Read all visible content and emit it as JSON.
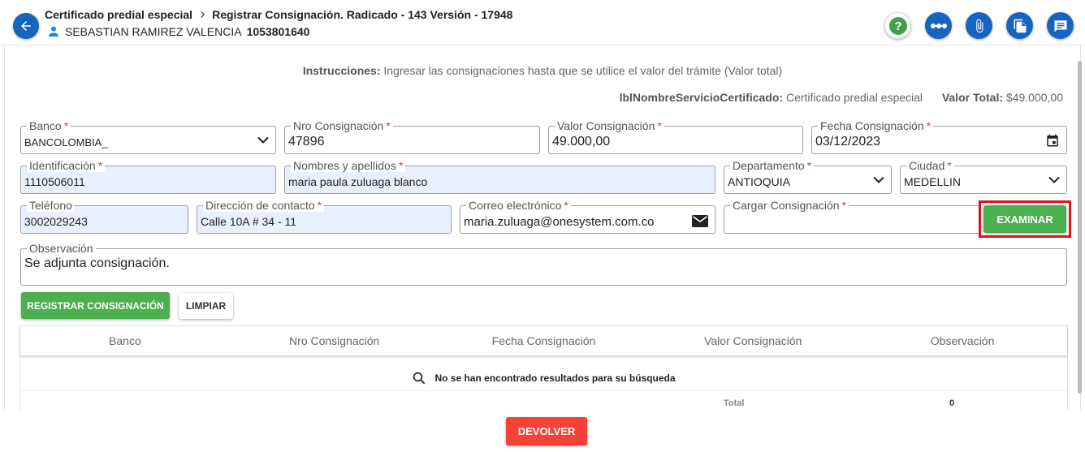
{
  "header": {
    "crumb_service": "Certificado predial especial",
    "crumb_step": "Registrar Consignación. Radicado - 143 Versión - 17948",
    "user_name": "SEBASTIAN RAMIREZ VALENCIA",
    "user_doc": "1053801640"
  },
  "info": {
    "instructions_label": "Instrucciones:",
    "instructions_text": "Ingresar las consignaciones hasta que se utilice el valor del trámite (Valor total)",
    "service_label": "lblNombreServicioCertificado:",
    "service_value": "Certificado predial especial",
    "total_label": "Valor Total:",
    "total_value": "$49.000,00"
  },
  "form": {
    "banco": {
      "label": "Banco",
      "value": "BANCOLOMBIA_"
    },
    "nro_consignacion": {
      "label": "Nro Consignación",
      "value": "47896"
    },
    "valor_consignacion": {
      "label": "Valor Consignación",
      "value": "49.000,00"
    },
    "fecha_consignacion": {
      "label": "Fecha Consignación",
      "value": "03/12/2023"
    },
    "identificacion": {
      "label": "Identificación",
      "value": "1110506011"
    },
    "nombres": {
      "label": "Nombres y apellidos",
      "value": "maria paula zuluaga blanco"
    },
    "departamento": {
      "label": "Departamento",
      "value": "ANTIOQUIA"
    },
    "ciudad": {
      "label": "Ciudad",
      "value": "MEDELLIN"
    },
    "telefono": {
      "label": "Teléfono",
      "value": "3002029243"
    },
    "direccion": {
      "label": "Dirección de contacto",
      "value": "Calle 10A # 34 - 11"
    },
    "correo": {
      "label": "Correo electrónico",
      "value": "maria.zuluaga@onesystem.com.co"
    },
    "cargar": {
      "label": "Cargar Consignación",
      "value": ""
    },
    "observacion": {
      "label": "Observación",
      "value": "Se adjunta consignación."
    },
    "required_mark": "*"
  },
  "buttons": {
    "examinar": "EXAMINAR",
    "registrar": "REGISTRAR CONSIGNACIÓN",
    "limpiar": "LIMPIAR",
    "devolver": "DEVOLVER"
  },
  "table": {
    "columns": [
      "Banco",
      "Nro Consignación",
      "Fecha Consignación",
      "Valor Consignación",
      "Observación"
    ],
    "empty_message": "No se han encontrado resultados para su búsqueda",
    "total_label": "Total",
    "total_value": "0"
  },
  "colors": {
    "primary": "#1565c0",
    "success": "#4caf50",
    "danger": "#f44336",
    "highlight_outline": "#e0111d",
    "autofill_bg": "#e8f0fe"
  },
  "icons": [
    "back-arrow-icon",
    "user-icon",
    "help-icon",
    "more-icon",
    "attachment-icon",
    "copy-icon",
    "notes-icon",
    "chevron-down-icon",
    "calendar-icon",
    "mail-icon",
    "search-icon"
  ]
}
